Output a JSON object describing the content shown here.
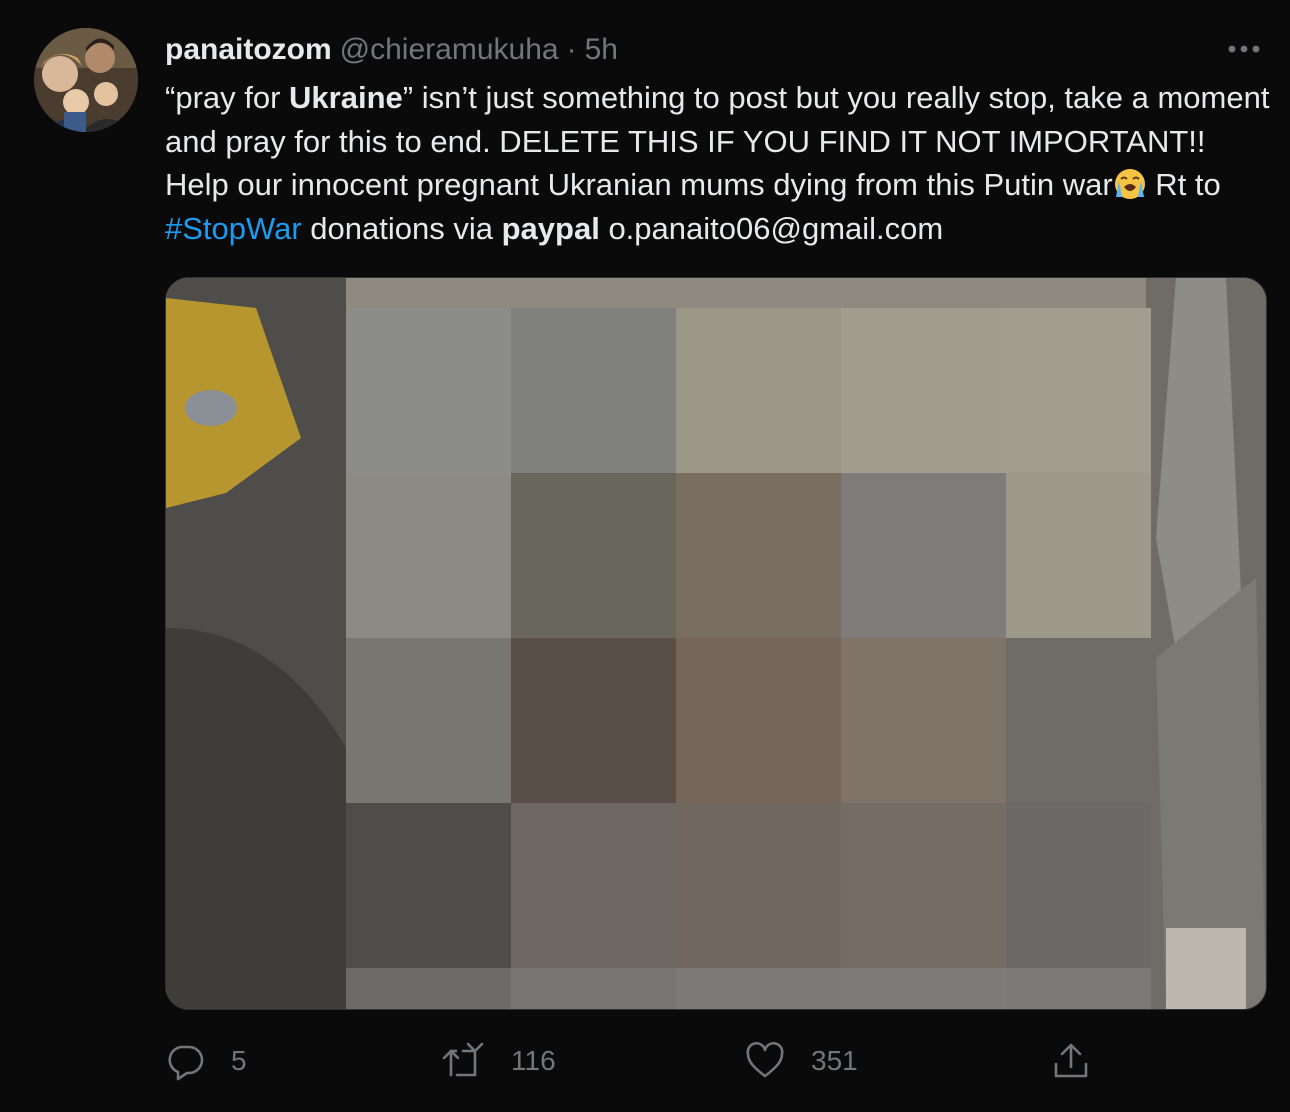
{
  "tweet": {
    "author": {
      "display_name": "panaitozom",
      "handle": "@chieramukuha",
      "separator": "·",
      "time": "5h"
    },
    "text": {
      "p1": "“pray for ",
      "bold1": "Ukraine",
      "p2": "” isn’t just something to post but you really stop, take a moment and pray for this to end. DELETE THIS IF YOU FIND IT NOT IMPORTANT!! Help our innocent pregnant Ukranian mums dying from this Putin war",
      "emoji": "loudly-crying-face",
      "p3": " Rt to ",
      "hashtag": "#StopWar",
      "p4": " donations via ",
      "bold2": "paypal",
      "p5": " o.panaito06@gmail.com"
    },
    "actions": {
      "reply_count": "5",
      "retweet_count": "116",
      "like_count": "351"
    }
  },
  "colors": {
    "background": "#0a0a0a",
    "text": "#e7e9ea",
    "muted": "#71767b",
    "link": "#1d9bf0"
  },
  "icons": [
    "more-icon",
    "reply-icon",
    "retweet-icon",
    "like-icon",
    "share-icon"
  ]
}
